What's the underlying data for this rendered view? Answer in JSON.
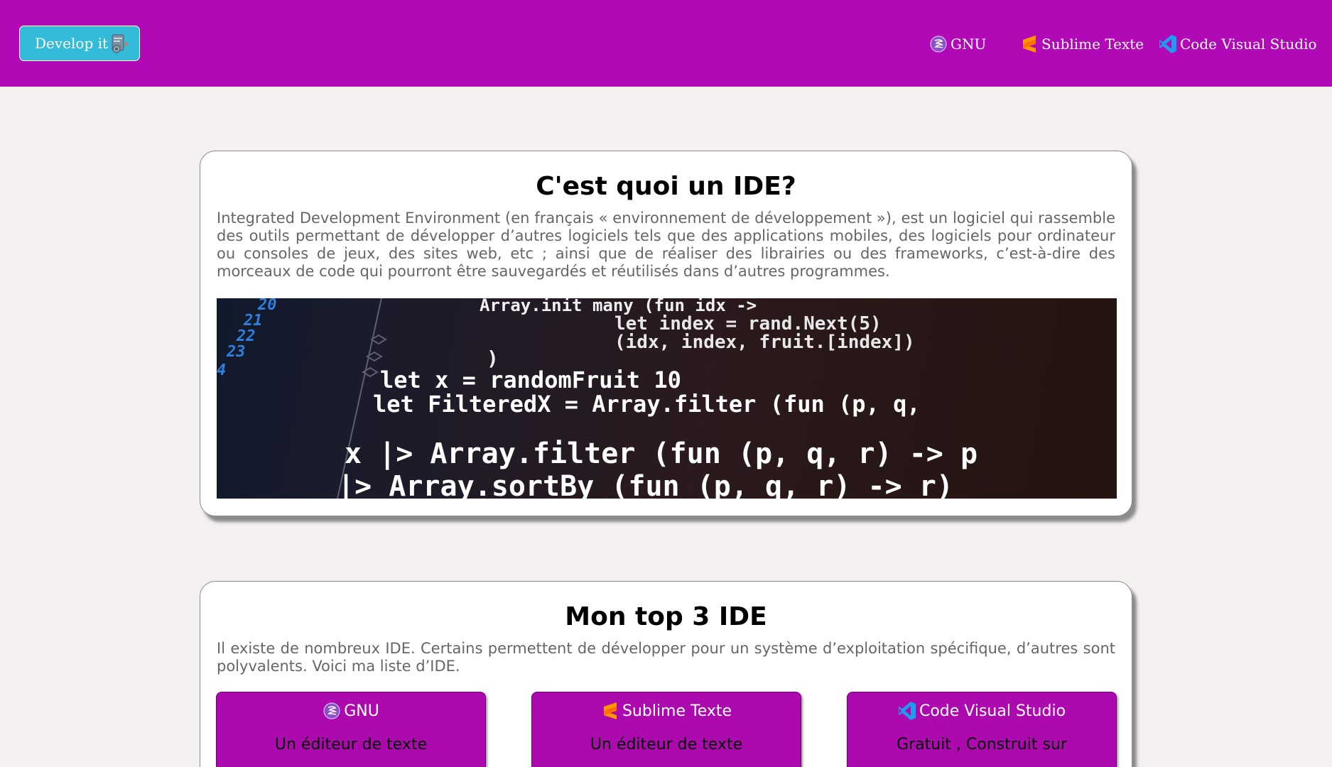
{
  "header": {
    "logo_text": "Develop it",
    "nav": [
      {
        "label": "GNU",
        "icon": "emacs-icon"
      },
      {
        "label": "Sublime Texte",
        "icon": "sublime-text-icon"
      },
      {
        "label": "Code Visual Studio",
        "icon": "vscode-icon"
      }
    ]
  },
  "section1": {
    "title": "C'est quoi un IDE?",
    "text": "Integrated Development Environment (en français « environnement de développement »), est un logiciel qui rassemble des outils permettant de développer d’autres logiciels tels que des applications mobiles, des logiciels pour ordinateur ou consoles de jeux, des sites web, etc ; ainsi que de réaliser des librairies ou des frameworks, c’est-à-dire des morceaux de code qui pourront être sauvegardés et réutilisés dans d’autres programmes.",
    "image": {
      "line_numbers": [
        "20",
        "21",
        "22",
        "23",
        "4"
      ],
      "lines": [
        "Array.init many (fun idx ->",
        "let index = rand.Next(5)",
        "(idx, index, fruit.[index])",
        ")",
        "let x = randomFruit 10",
        "let FilteredX = Array.filter (fun (p, q,",
        "x |> Array.filter (fun (p, q, r) -> p",
        "|> Array.sortBy (fun (p, q, r) -> r)"
      ]
    }
  },
  "section2": {
    "title": "Mon top 3 IDE",
    "text": "Il existe de nombreux IDE. Certains permettent de développer pour un système d’exploitation spécifique, d’autres sont polyvalents. Voici ma liste d’IDE.",
    "ides": [
      {
        "name": "GNU",
        "icon": "emacs-icon",
        "desc": "Un éditeur de texte"
      },
      {
        "name": "Sublime Texte",
        "icon": "sublime-text-icon",
        "desc": "Un éditeur de texte"
      },
      {
        "name": "Code Visual Studio",
        "icon": "vscode-icon",
        "desc": "Gratuit , Construit sur"
      }
    ]
  },
  "colors": {
    "header_bg": "#b109b5",
    "logo_bg": "#33bbd9",
    "ide_box_bg": "#ac09ae",
    "page_bg": "#f3f0ef"
  }
}
